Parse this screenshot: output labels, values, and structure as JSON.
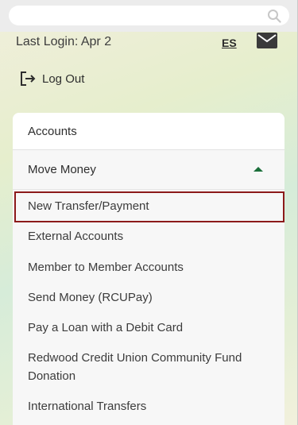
{
  "header": {
    "search_placeholder": ""
  },
  "account_bar": {
    "last_login": "Last Login: Apr 2",
    "language_link": "ES",
    "logout_label": "Log Out"
  },
  "menu": {
    "accounts_label": "Accounts",
    "move_money_label": "Move Money",
    "move_money_items": [
      "New Transfer/Payment",
      "External Accounts",
      "Member to Member Accounts",
      "Send Money (RCUPay)",
      "Pay a Loan with a Debit Card",
      "Redwood Credit Union Community Fund",
      "Donation",
      "International Transfers"
    ],
    "selected_item": "New Transfer/Payment"
  },
  "colors": {
    "accent_green": "#1b6f3a",
    "highlight_border": "#8c1a1a"
  },
  "icons": {
    "search": "search-icon",
    "mail": "mail-icon",
    "logout": "logout-icon",
    "caret": "caret-up-icon"
  }
}
